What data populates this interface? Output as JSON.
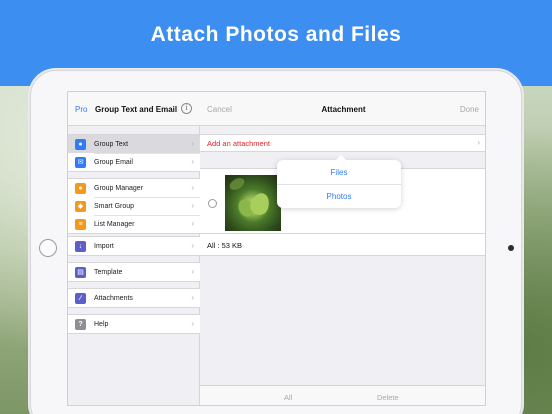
{
  "banner": {
    "title": "Attach Photos and Files"
  },
  "left_panel": {
    "pro_label": "Pro",
    "title": "Group Text and Email",
    "info_icon": "i",
    "groups": [
      [
        {
          "label": "Group Text",
          "icon": "chat-bubble-icon",
          "color": "#2f7cf6",
          "selected": true
        },
        {
          "label": "Group Email",
          "icon": "envelope-icon",
          "color": "#2f7cf6",
          "selected": false
        }
      ],
      [
        {
          "label": "Group Manager",
          "icon": "people-icon",
          "color": "#f39a1e",
          "selected": false
        },
        {
          "label": "Smart Group",
          "icon": "smart-group-icon",
          "color": "#f39a1e",
          "selected": false
        },
        {
          "label": "List Manager",
          "icon": "list-icon",
          "color": "#f39a1e",
          "selected": false
        }
      ],
      [
        {
          "label": "Import",
          "icon": "import-icon",
          "color": "#5b5fc7",
          "selected": false
        }
      ],
      [
        {
          "label": "Template",
          "icon": "template-icon",
          "color": "#5b5fc7",
          "selected": false
        }
      ],
      [
        {
          "label": "Attachments",
          "icon": "paperclip-icon",
          "color": "#5b5fc7",
          "selected": false
        }
      ],
      [
        {
          "label": "Help",
          "icon": "help-icon",
          "color": "#8e8e93",
          "selected": false
        }
      ]
    ]
  },
  "right_panel": {
    "cancel_label": "Cancel",
    "title": "Attachment",
    "done_label": "Done",
    "add_attachment_label": "Add an attachment",
    "popover": {
      "files_label": "Files",
      "photos_label": "Photos"
    },
    "size_label": "All : 53 KB",
    "bottom": {
      "all_label": "All",
      "delete_label": "Delete"
    }
  }
}
